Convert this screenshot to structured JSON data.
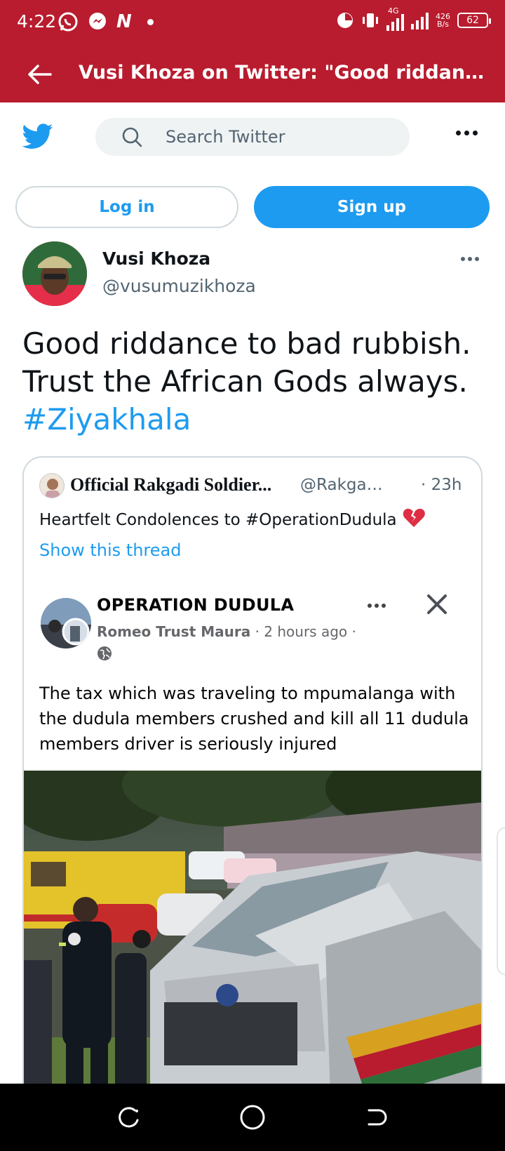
{
  "status_bar": {
    "time": "4:22",
    "network_type": "4G",
    "speed_value": "426",
    "speed_unit": "B/s",
    "battery": "62"
  },
  "app_bar": {
    "title": "Vusi Khoza on Twitter: \"Good riddance to b...",
    "back_icon": "arrow-left-icon"
  },
  "twitter_header": {
    "logo_icon": "twitter-bird-icon",
    "search_placeholder": "Search Twitter",
    "more_icon": "more-horizontal-icon"
  },
  "auth": {
    "login_label": "Log in",
    "signup_label": "Sign up"
  },
  "tweet": {
    "author_name": "Vusi Khoza",
    "author_handle": "@vusumuzikhoza",
    "text_line1": "Good riddance to bad rubbish.",
    "text_line2": "Trust the African Gods always.",
    "hashtag": "#Ziyakhala"
  },
  "quoted_tweet": {
    "author_name": "Official Rakgadi Soldier...",
    "author_handle": "@Rakgadi_...",
    "time": "· 23h",
    "text": "Heartfelt Condolences to #OperationDudula",
    "emoji_icon": "broken-heart-icon",
    "show_thread": "Show this thread"
  },
  "embedded_post": {
    "page_name": "OPERATION DUDULA",
    "poster": "Romeo Trust Maura",
    "meta": "· 2 hours ago ·",
    "body": "The tax which was traveling to mpumalanga with the dudula members crushed and kill all 11 dudula members driver is seriously injured"
  },
  "colors": {
    "chrome_red": "#b81c2e",
    "twitter_blue": "#1d9bf0",
    "text_dark": "#0f1419",
    "text_muted": "#536471"
  }
}
